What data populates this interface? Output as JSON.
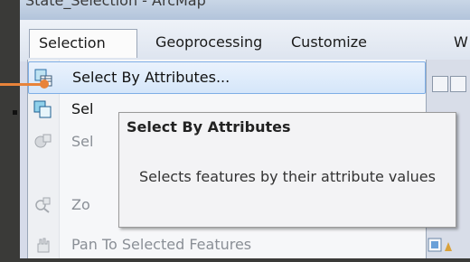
{
  "window": {
    "title": "State_Selection - ArcMap"
  },
  "menubar": {
    "items": [
      {
        "label": "Selection",
        "active": true
      },
      {
        "label": "Geoprocessing"
      },
      {
        "label": "Customize"
      },
      {
        "label": "W"
      }
    ]
  },
  "dropdown": {
    "items": [
      {
        "label": "Select By Attributes...",
        "icon": "select-by-attributes-icon",
        "highlighted": true
      },
      {
        "label": "Sel",
        "icon": "select-by-location-icon"
      },
      {
        "label": "Sel",
        "icon": "select-by-graphics-icon",
        "disabled": true
      },
      {
        "label": "Zo",
        "icon": "zoom-to-selected-icon",
        "disabled": true
      },
      {
        "label": "Pan To Selected Features",
        "icon": "pan-to-selected-icon",
        "disabled": true
      }
    ]
  },
  "tooltip": {
    "title": "Select By Attributes",
    "description": "Selects features by their attribute values"
  },
  "colors": {
    "callout": "#e8833a",
    "highlight_border": "#7eaee6",
    "highlight_fill": "#d5e6fa"
  }
}
